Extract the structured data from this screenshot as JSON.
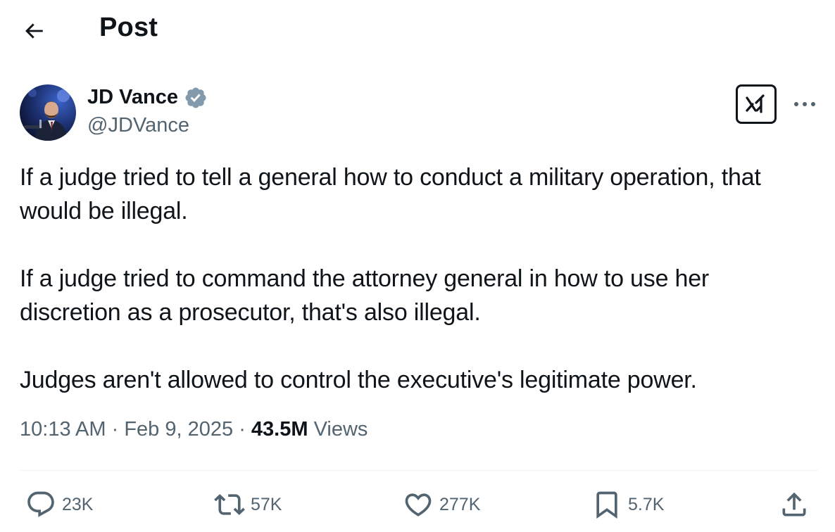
{
  "header": {
    "title": "Post",
    "back_icon": "arrow-left-icon"
  },
  "author": {
    "display_name": "JD Vance",
    "handle": "@JDVance",
    "verified": true,
    "verified_color": "#829aab",
    "grok_icon": "grok-icon",
    "more_icon": "more-horizontal-icon"
  },
  "tweet": {
    "paragraphs": [
      "If a judge tried to tell a general how to conduct a military operation, that would be illegal.",
      "If a judge tried to command the attorney general in how to use her discretion as a prosecutor, that's also illegal.",
      "Judges aren't allowed to control the executive's legitimate power."
    ]
  },
  "meta": {
    "time": "10:13 AM",
    "separator": "·",
    "date": "Feb 9, 2025",
    "views_count": "43.5M",
    "views_label": "Views"
  },
  "actions": {
    "replies": "23K",
    "reposts": "57K",
    "likes": "277K",
    "bookmarks": "5.7K"
  },
  "colors": {
    "text": "#0f1419",
    "secondary": "#536471",
    "divider": "#eff3f4"
  }
}
